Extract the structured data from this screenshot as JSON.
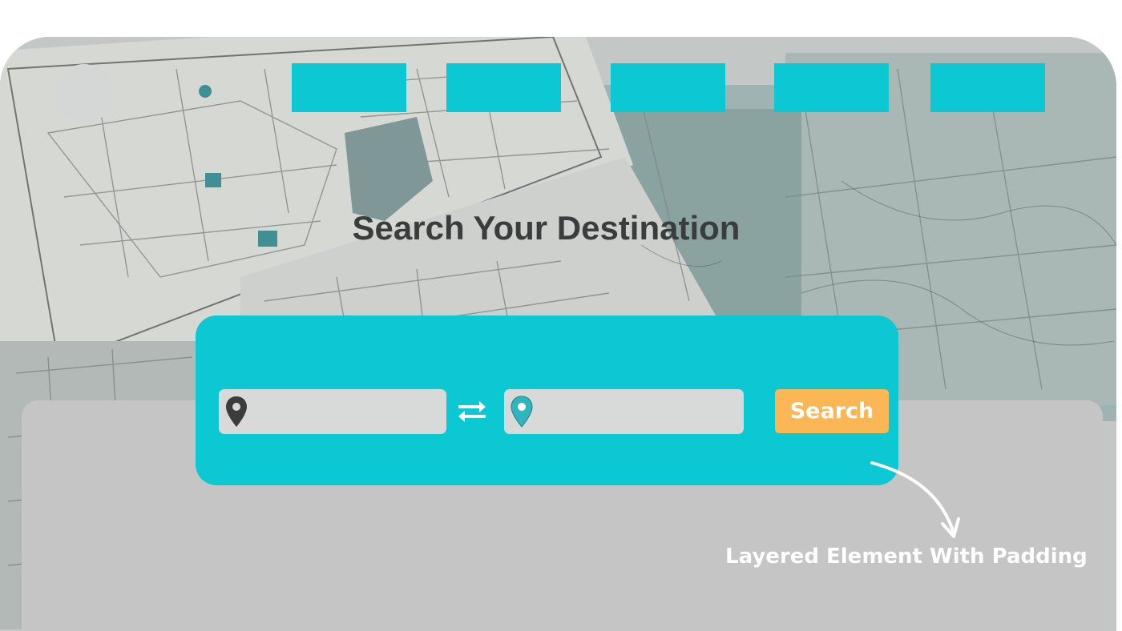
{
  "background": {
    "description_icon": "map-collage-background"
  },
  "nav": {
    "items": [
      {
        "label": ""
      },
      {
        "label": ""
      },
      {
        "label": ""
      },
      {
        "label": ""
      },
      {
        "label": ""
      }
    ]
  },
  "hero": {
    "title": "Search Your Destination"
  },
  "search": {
    "from_value": "",
    "to_value": "",
    "from_icon": "location-pin-icon",
    "to_icon": "location-pin-icon",
    "swap_icon": "swap-arrows-icon",
    "button_label": "Search"
  },
  "annotation": {
    "text": "Layered Element With Padding"
  },
  "colors": {
    "accent": "#0bc8d3",
    "button": "#fbb756",
    "panel": "#c4c5c4",
    "title": "#3a3d3d",
    "pin_dark": "#3c3c3c",
    "pin_accent": "#2fb4c0"
  }
}
